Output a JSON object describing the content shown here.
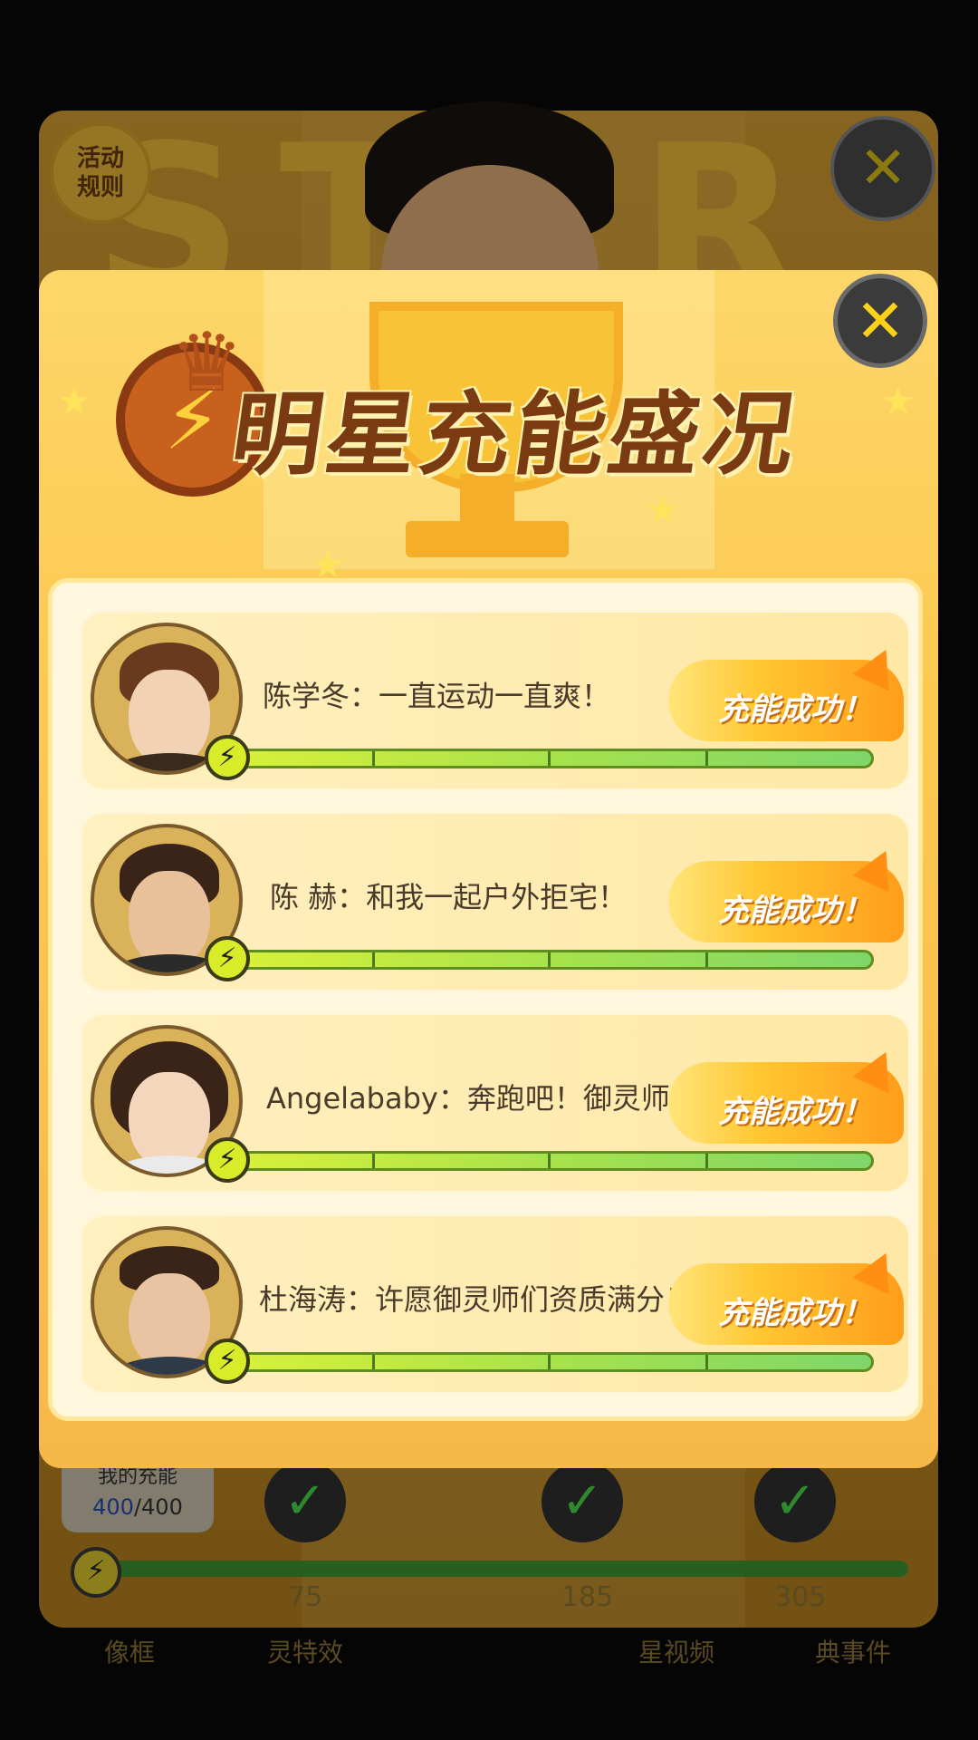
{
  "background_panel": {
    "big_text": "STAR",
    "rules_button": "活动\n规则",
    "close_glyph": "✕",
    "my_energy_label": "我的充能",
    "my_energy_current": "400",
    "my_energy_total": "/400",
    "milestones": [
      "75",
      "185",
      "305"
    ],
    "milestone_checks": [
      "✓",
      "✓",
      "✓"
    ],
    "reward_labels": [
      "像框",
      "灵特效",
      "星视频",
      "典事件"
    ],
    "bolt_glyph": "⚡"
  },
  "modal": {
    "title": "明星充能盛况",
    "close_glyph": "✕",
    "badge_glyph": "⚡",
    "crown_glyph": "♛",
    "cards": [
      {
        "quote": "陈学冬：一直运动一直爽！",
        "status": "充能成功！",
        "progress": 1.0
      },
      {
        "quote": "陈 赫：和我一起户外拒宅！",
        "status": "充能成功！",
        "progress": 1.0
      },
      {
        "quote": "Angelababy：奔跑吧！御灵师",
        "status": "充能成功！",
        "progress": 1.0
      },
      {
        "quote": "杜海涛：许愿御灵师们资质满分！",
        "status": "充能成功！",
        "progress": 1.0
      }
    ],
    "bolt_glyph": "⚡"
  },
  "colors": {
    "accent": "#fbc950",
    "title": "#7a3a12",
    "bar": "#a7e24c"
  }
}
